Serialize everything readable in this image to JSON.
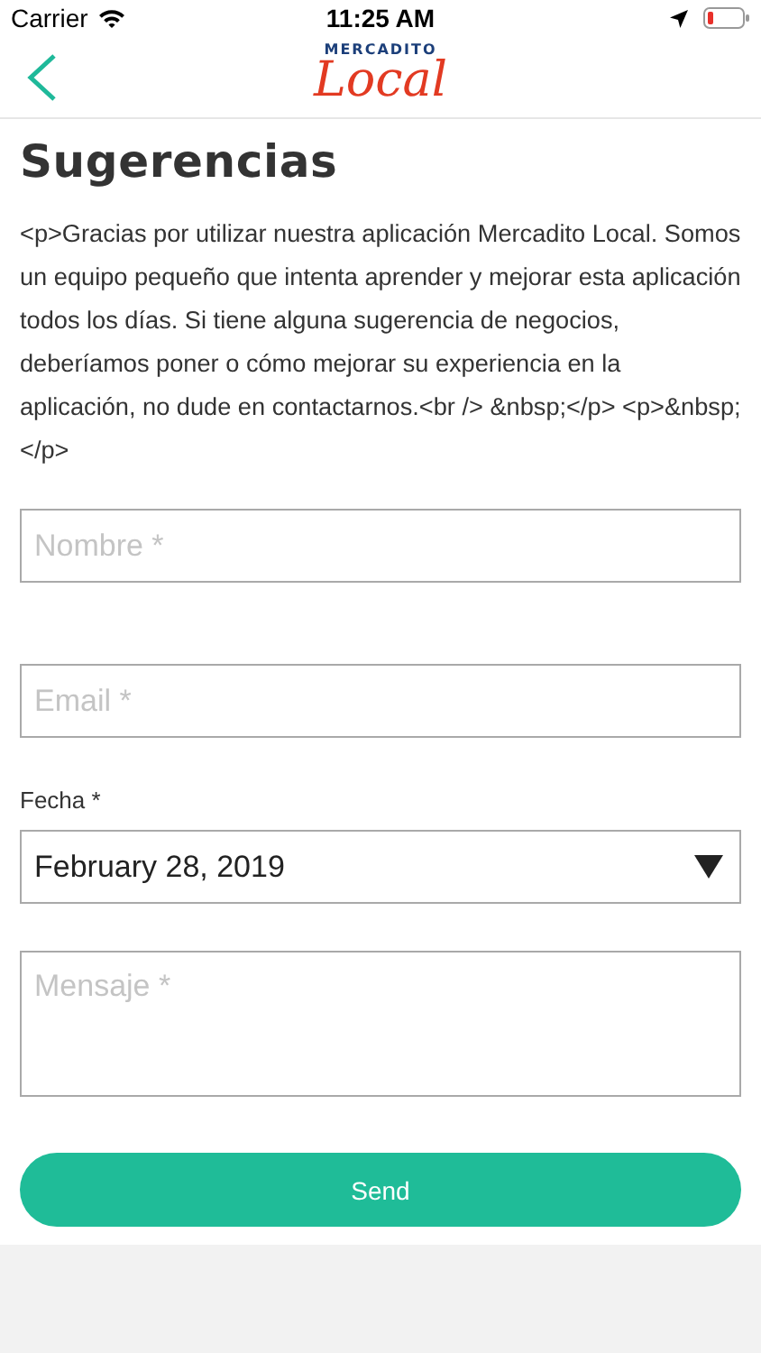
{
  "status_bar": {
    "carrier": "Carrier",
    "time": "11:25 AM"
  },
  "nav": {
    "logo_top": "MERCADITO",
    "logo_bottom": "Local"
  },
  "title": "Sugerencias",
  "intro": "<p>Gracias por utilizar nuestra aplicación Mercadito Local. Somos un equipo pequeño que intenta aprender y mejorar esta aplicación todos los días. Si tiene alguna sugerencia de negocios, deberíamos poner o cómo mejorar su experiencia en la aplicación, no dude en contactarnos.<br /> &nbsp;</p> <p>&nbsp;</p>",
  "fields": [
    {
      "kind": "text",
      "placeholder": "Nombre *"
    },
    {
      "kind": "text",
      "placeholder": "Email *"
    },
    {
      "kind": "date",
      "label": "Fecha *",
      "value": "February 28, 2019"
    },
    {
      "kind": "textarea",
      "placeholder": "Mensaje *"
    }
  ],
  "button": "Send"
}
